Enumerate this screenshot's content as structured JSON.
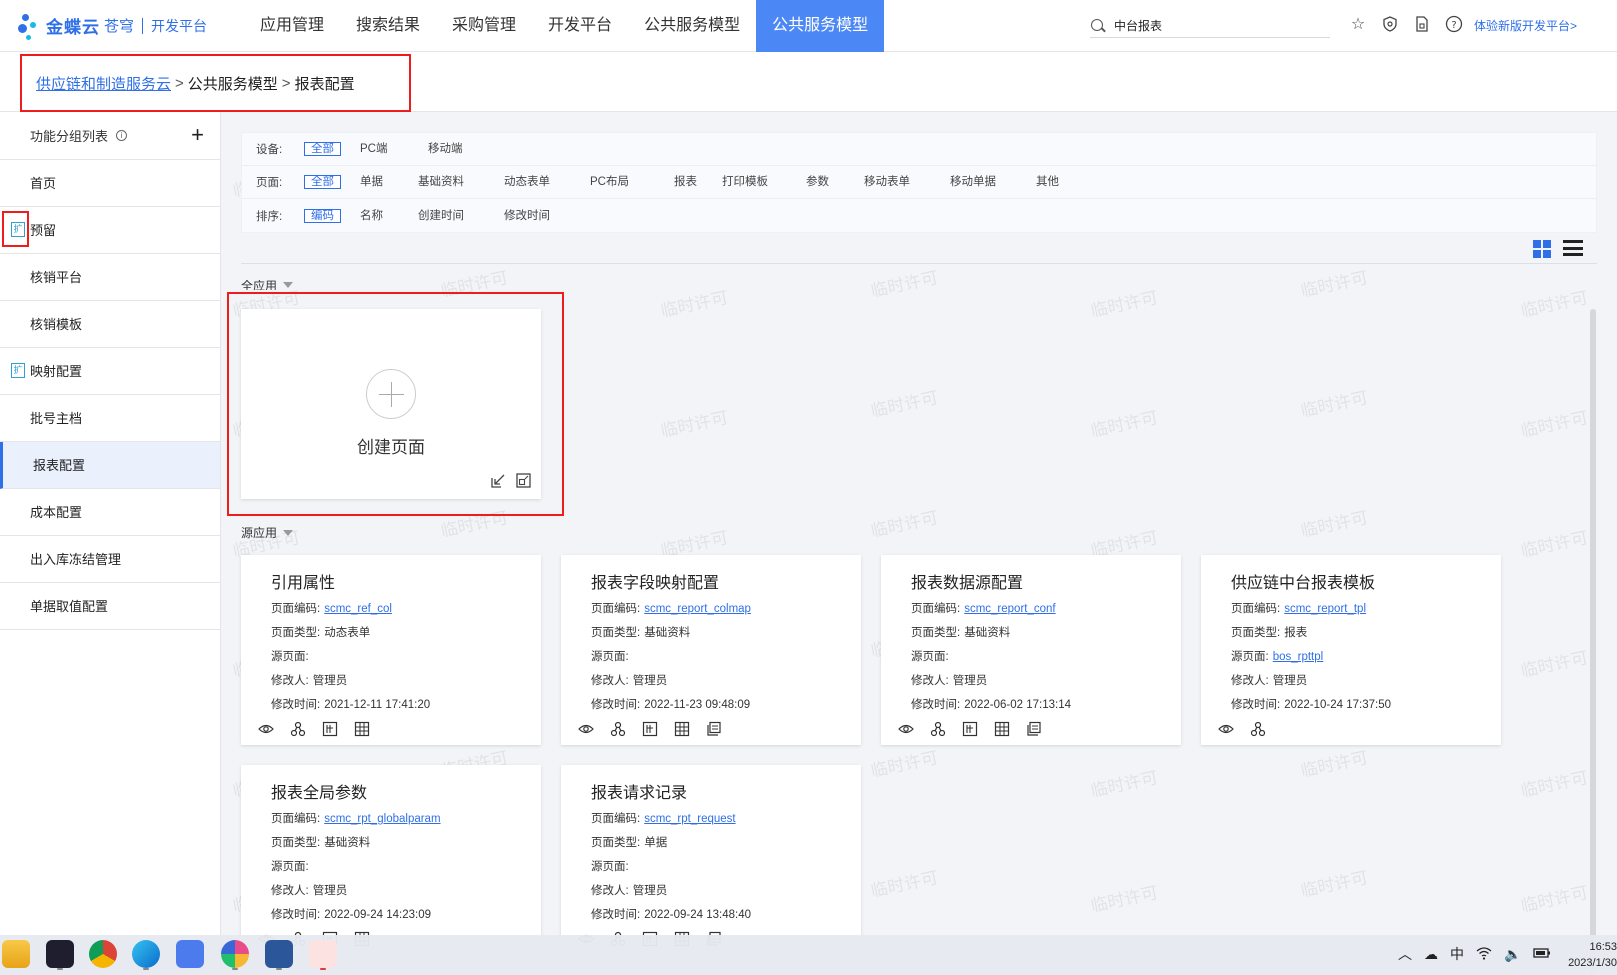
{
  "logo": {
    "brand": "金蝶云",
    "product": "苍穹",
    "platform": "开发平台"
  },
  "nav": [
    {
      "label": "应用管理",
      "active": false
    },
    {
      "label": "搜索结果",
      "active": false
    },
    {
      "label": "采购管理",
      "active": false
    },
    {
      "label": "开发平台",
      "active": false
    },
    {
      "label": "公共服务模型",
      "active": false
    },
    {
      "label": "公共服务模型",
      "active": true
    }
  ],
  "search": {
    "value": "中台报表"
  },
  "header": {
    "new_version_link": "体验新版开发平台>"
  },
  "breadcrumb": {
    "root": "供应链和制造服务云",
    "mid": "公共服务模型",
    "current": "报表配置",
    "sep": ">"
  },
  "sidebar": {
    "title": "功能分组列表",
    "add_label": "+",
    "items": [
      {
        "label": "首页"
      },
      {
        "label": "预留",
        "icon": "扩"
      },
      {
        "label": "核销平台"
      },
      {
        "label": "核销模板"
      },
      {
        "label": "映射配置",
        "icon": "扩"
      },
      {
        "label": "批号主档"
      },
      {
        "label": "报表配置",
        "active": true
      },
      {
        "label": "成本配置"
      },
      {
        "label": "出入库冻结管理"
      },
      {
        "label": "单据取值配置"
      }
    ]
  },
  "filters": {
    "device": {
      "label": "设备:",
      "options": [
        "全部",
        "PC端",
        "移动端"
      ],
      "selected": "全部"
    },
    "page": {
      "label": "页面:",
      "options": [
        "全部",
        "单据",
        "基础资料",
        "动态表单",
        "PC布局",
        "报表",
        "打印模板",
        "参数",
        "移动表单",
        "移动单据",
        "其他"
      ],
      "selected": "全部"
    },
    "sort": {
      "label": "排序:",
      "options": [
        "编码",
        "名称",
        "创建时间",
        "修改时间"
      ],
      "selected": "编码"
    }
  },
  "groups": {
    "current_app": "全应用",
    "source_app": "源应用"
  },
  "create_card": {
    "title": "创建页面"
  },
  "field_labels": {
    "code": "页面编码:",
    "type": "页面类型:",
    "source": "源页面:",
    "modifier": "修改人:",
    "modified": "修改时间:"
  },
  "cards": [
    {
      "title": "引用属性",
      "code": "scmc_ref_col",
      "type": "动态表单",
      "source": "",
      "modifier": "管理员",
      "modified": "2021-12-11 17:41:20"
    },
    {
      "title": "报表字段映射配置",
      "code": "scmc_report_colmap",
      "type": "基础资料",
      "source": "",
      "modifier": "管理员",
      "modified": "2022-11-23 09:48:09"
    },
    {
      "title": "报表数据源配置",
      "code": "scmc_report_conf",
      "type": "基础资料",
      "source": "",
      "modifier": "管理员",
      "modified": "2022-06-02 17:13:14"
    },
    {
      "title": "供应链中台报表模板",
      "code": "scmc_report_tpl",
      "type": "报表",
      "source": "bos_rpttpl",
      "modifier": "管理员",
      "modified": "2022-10-24 17:37:50"
    },
    {
      "title": "报表全局参数",
      "code": "scmc_rpt_globalparam",
      "type": "基础资料",
      "source": "",
      "modifier": "管理员",
      "modified": "2022-09-24 14:23:09"
    },
    {
      "title": "报表请求记录",
      "code": "scmc_rpt_request",
      "type": "单据",
      "source": "",
      "modifier": "管理员",
      "modified": "2022-09-24 13:48:40"
    }
  ],
  "watermark": "临时许可",
  "taskbar": {
    "tray_ime": "中",
    "time": "16:53",
    "date": "2023/1/30"
  },
  "colors": {
    "accent": "#2f6fe8",
    "nav_active": "#4c88f5",
    "highlight_box": "#ee1c1c"
  }
}
